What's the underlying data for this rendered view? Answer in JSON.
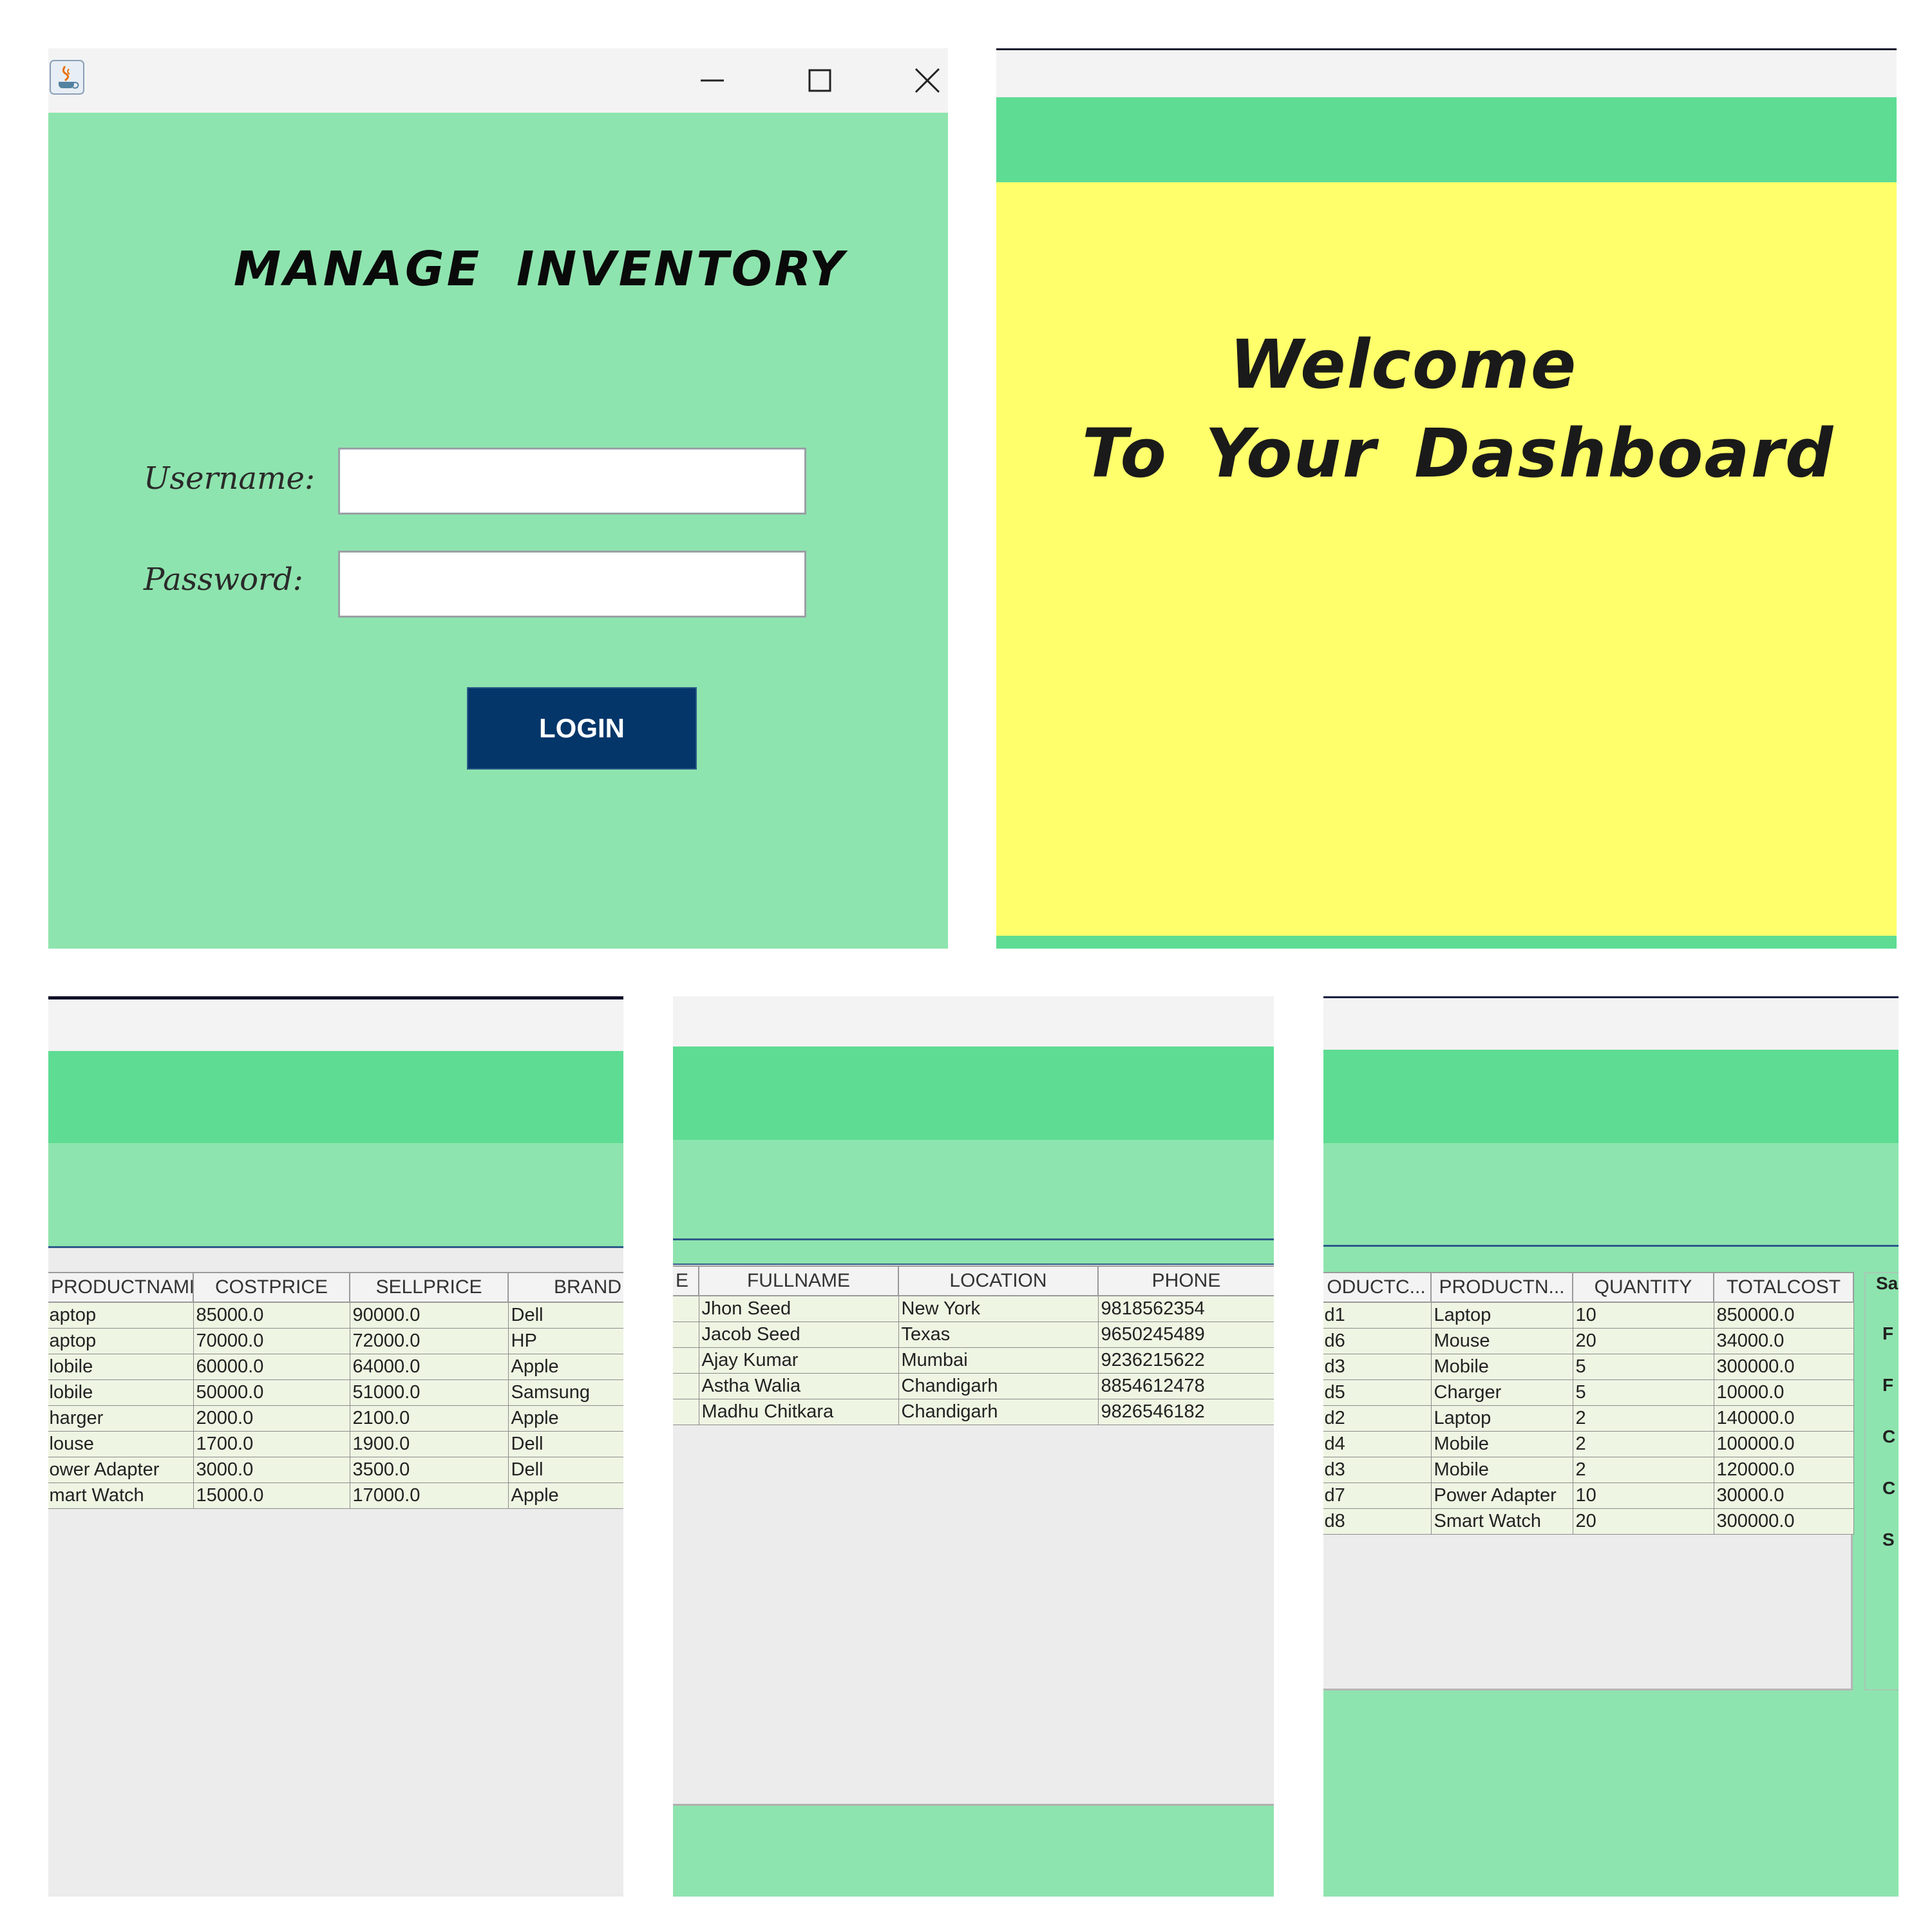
{
  "login": {
    "title": "MANAGE  INVENTORY",
    "username_label": "Username:",
    "password_label": "Password:",
    "username_value": "",
    "password_value": "",
    "login_button": "LOGIN",
    "controls": {
      "minimize": "—",
      "maximize": "☐",
      "close": "✕"
    }
  },
  "dashboard": {
    "welcome_line_1": "Welcome",
    "welcome_line_2": "To Your Dashboard"
  },
  "products_table": {
    "columns": [
      "PRODUCTNAME",
      "COSTPRICE",
      "SELLPRICE",
      "BRAND"
    ],
    "rows": [
      [
        "aptop",
        "85000.0",
        "90000.0",
        "Dell"
      ],
      [
        "aptop",
        "70000.0",
        "72000.0",
        "HP"
      ],
      [
        "lobile",
        "60000.0",
        "64000.0",
        "Apple"
      ],
      [
        "lobile",
        "50000.0",
        "51000.0",
        "Samsung"
      ],
      [
        "harger",
        "2000.0",
        "2100.0",
        "Apple"
      ],
      [
        "louse",
        "1700.0",
        "1900.0",
        "Dell"
      ],
      [
        "ower Adapter",
        "3000.0",
        "3500.0",
        "Dell"
      ],
      [
        "mart Watch",
        "15000.0",
        "17000.0",
        "Apple"
      ]
    ]
  },
  "customers_table": {
    "columns": [
      "E",
      "FULLNAME",
      "LOCATION",
      "PHONE"
    ],
    "rows": [
      [
        "",
        "Jhon Seed",
        "New York",
        "9818562354"
      ],
      [
        "",
        "Jacob Seed",
        "Texas",
        "9650245489"
      ],
      [
        "",
        "Ajay Kumar",
        "Mumbai",
        "9236215622"
      ],
      [
        "",
        "Astha Walia",
        "Chandigarh",
        "8854612478"
      ],
      [
        "",
        "Madhu Chitkara",
        "Chandigarh",
        "9826546182"
      ]
    ]
  },
  "sales_table": {
    "columns": [
      "ODUCTC...",
      "PRODUCTN...",
      "QUANTITY",
      "TOTALCOST"
    ],
    "rows": [
      [
        "d1",
        "Laptop",
        "10",
        "850000.0"
      ],
      [
        "d6",
        "Mouse",
        "20",
        "34000.0"
      ],
      [
        "d3",
        "Mobile",
        "5",
        "300000.0"
      ],
      [
        "d5",
        "Charger",
        "5",
        "10000.0"
      ],
      [
        "d2",
        "Laptop",
        "2",
        "140000.0"
      ],
      [
        "d4",
        "Mobile",
        "2",
        "100000.0"
      ],
      [
        "d3",
        "Mobile",
        "2",
        "120000.0"
      ],
      [
        "d7",
        "Power Adapter",
        "10",
        "30000.0"
      ],
      [
        "d8",
        "Smart Watch",
        "20",
        "300000.0"
      ]
    ],
    "side_letters": [
      "Sa",
      "F",
      "F",
      "C",
      "C",
      "S"
    ]
  },
  "colors": {
    "green_light": "#8ee4ae",
    "green_dark": "#5edc93",
    "yellow": "#ffff6b",
    "navy_button": "#04366a"
  }
}
